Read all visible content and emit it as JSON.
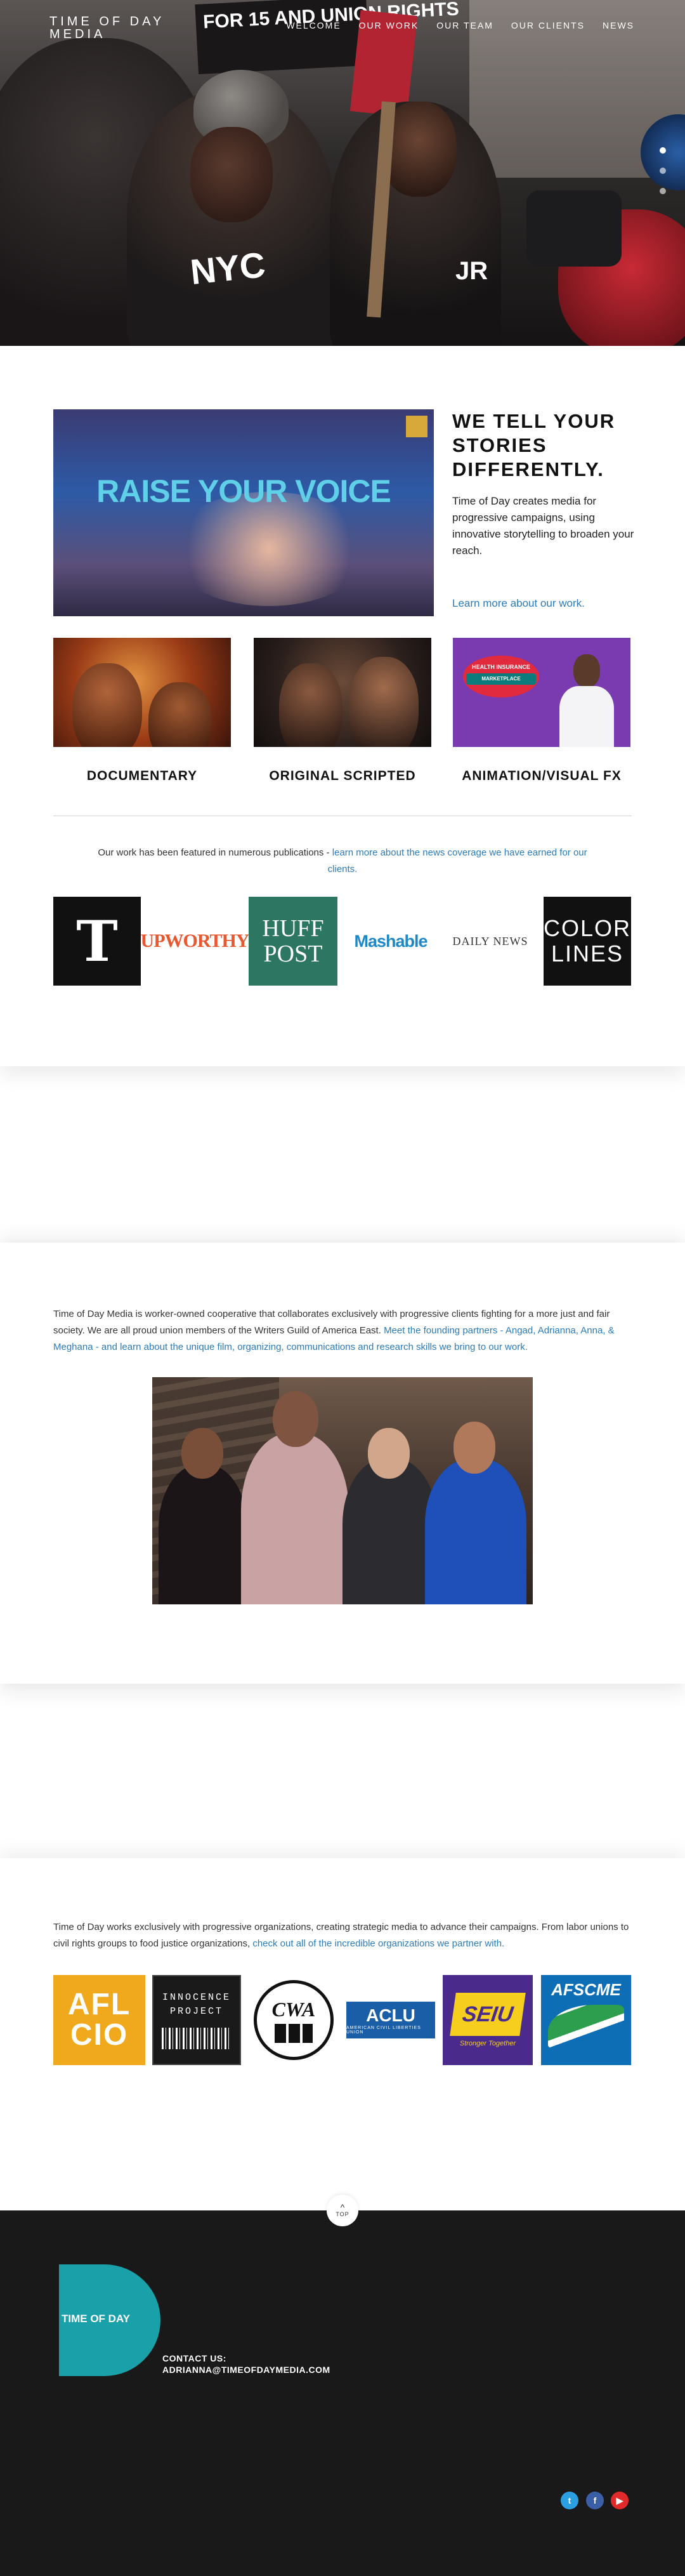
{
  "site": {
    "logo_line1": "TIME OF DAY",
    "logo_line2": "MEDIA"
  },
  "nav": {
    "items": [
      "WELCOME",
      "OUR WORK",
      "OUR TEAM",
      "OUR CLIENTS",
      "NEWS"
    ]
  },
  "hero": {
    "sign_text": "FOR 15 AND UNION RIGHTS",
    "shirt_text_1": "NYC",
    "shirt_text_2": "JR"
  },
  "work": {
    "video_title": "RAISE YOUR VOICE",
    "headline": "WE TELL YOUR STORIES DIFFERENTLY.",
    "intro": "Time of Day creates media for progressive campaigns, using innovative storytelling to broaden your reach.",
    "learn_link": "Learn more about our work.",
    "categories": [
      "DOCUMENTARY",
      "ORIGINAL SCRIPTED",
      "ANIMATION/VISUAL FX"
    ],
    "marketplace_top": "HEALTH INSURANCE",
    "marketplace_band": "MARKETPLACE",
    "featured_text": "Our work has been featured in numerous publications - ",
    "featured_link": "learn more about the news coverage we have earned for our clients.",
    "publications": {
      "nyt": "T",
      "upworthy": "UPWORTHY",
      "huff_1": "HUFF",
      "huff_2": "POST",
      "mashable": "Mashable",
      "daily_news": "DAILY NEWS",
      "color_1": "COLOR",
      "color_2": "LINES"
    }
  },
  "team": {
    "text": "Time of Day Media is worker-owned cooperative that collaborates exclusively with progressive clients fighting for a more just and fair society. We are all proud union members of the Writers Guild of America East. ",
    "link": "Meet the founding partners - Angad, Adrianna, Anna, & Meghana - and learn about the unique film, organizing, communications and research skills we bring to our work."
  },
  "clients": {
    "text": "Time of Day works exclusively with progressive organizations, creating strategic media to advance their campaigns. From labor unions to civil rights groups to food justice organizations, ",
    "link": "check out all of the incredible organizations we partner with.",
    "afl_1": "AFL",
    "afl_2": "CIO",
    "innocence_1": "INNOCENCE",
    "innocence_2": "PROJECT",
    "cwa": "CWA",
    "aclu": "ACLU",
    "aclu_sub": "AMERICAN CIVIL LIBERTIES UNION",
    "seiu": "SEIU",
    "seiu_sub": "Stronger Together",
    "afscme": "AFSCME"
  },
  "top_button": {
    "label": "TOP"
  },
  "footer": {
    "logo_text": "TIME OF DAY",
    "contact_label": "CONTACT US:",
    "contact_email": "ADRIANNA@TIMEOFDAYMEDIA.COM",
    "social": [
      "twitter-icon",
      "facebook-icon",
      "youtube-icon"
    ]
  },
  "colors": {
    "link": "#2b7bb9",
    "footer_bg": "#191919",
    "brand_teal": "#1aa0a8"
  }
}
